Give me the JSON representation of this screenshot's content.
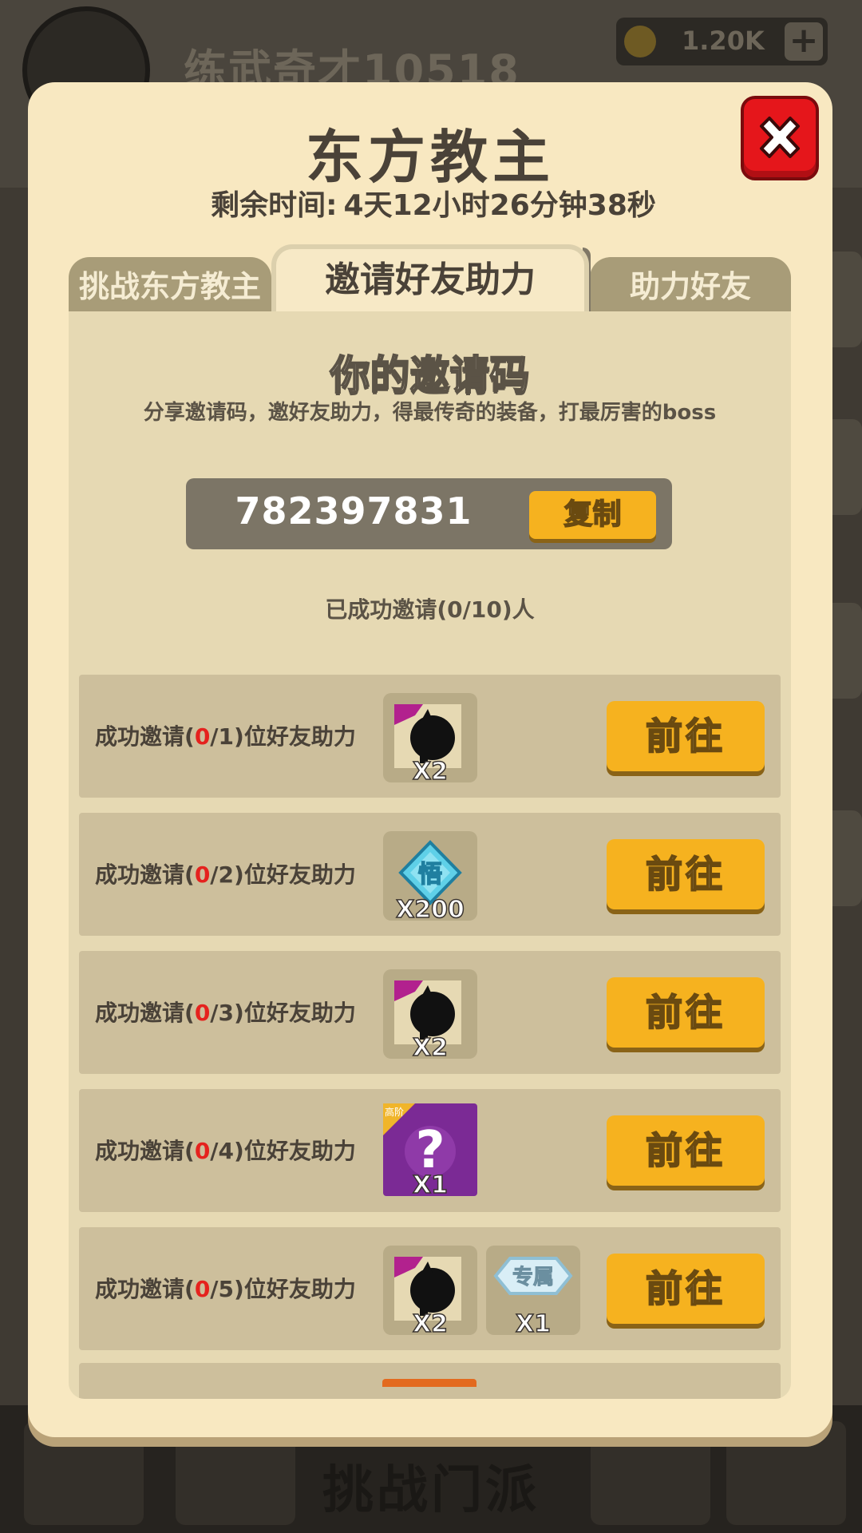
{
  "background": {
    "player_name": "练武奇才10518",
    "coins": "1.20K",
    "coin_plus": "+",
    "bottom_title": "挑战门派"
  },
  "modal": {
    "title": "东方教主",
    "remaining_label": "剩余时间:",
    "remaining_value": "4天12小时26分钟38秒",
    "close_icon": "close-x-icon"
  },
  "tabs": [
    {
      "label": "挑战东方教主",
      "active": false
    },
    {
      "label": "邀请好友助力",
      "active": true
    },
    {
      "label": "助力好友",
      "active": false
    }
  ],
  "invite": {
    "title": "你的邀请码",
    "description": "分享邀请码，邀好友助力，得最传奇的装备，打最厉害的boss",
    "code": "782397831",
    "copy_label": "复制",
    "invited_text": "已成功邀请(0/10)人"
  },
  "tasks": [
    {
      "prefix": "成功邀请(",
      "done": "0",
      "total": "/1",
      "suffix": ")位好友助力",
      "rewards": [
        {
          "icon": "ninja-character-icon",
          "count": "X2"
        }
      ],
      "button": "前往"
    },
    {
      "prefix": "成功邀请(",
      "done": "0",
      "total": "/2",
      "suffix": ")位好友助力",
      "rewards": [
        {
          "icon": "wu-gem-icon",
          "glyph": "悟",
          "count": "X200"
        }
      ],
      "button": "前往"
    },
    {
      "prefix": "成功邀请(",
      "done": "0",
      "total": "/3",
      "suffix": ")位好友助力",
      "rewards": [
        {
          "icon": "ninja-character-icon",
          "count": "X2"
        }
      ],
      "button": "前往"
    },
    {
      "prefix": "成功邀请(",
      "done": "0",
      "total": "/4",
      "suffix": ")位好友助力",
      "rewards": [
        {
          "icon": "mystery-box-icon",
          "tag": "高阶",
          "count": "X1"
        }
      ],
      "button": "前往"
    },
    {
      "prefix": "成功邀请(",
      "done": "0",
      "total": "/5",
      "suffix": ")位好友助力",
      "rewards": [
        {
          "icon": "ninja-character-icon",
          "count": "X2"
        },
        {
          "icon": "exclusive-badge-icon",
          "glyph": "专属",
          "count": "X1"
        }
      ],
      "button": "前往"
    }
  ],
  "colors": {
    "modal_bg": "#f8e8c1",
    "panel_bg": "#e6d9b3",
    "row_bg": "#cdbf9c",
    "button_orange": "#f6b21f",
    "close_red": "#e5161b",
    "progress_red": "#e5221e"
  }
}
